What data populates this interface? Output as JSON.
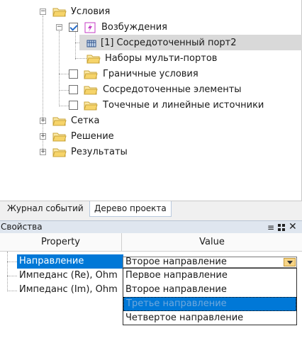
{
  "tree": {
    "nodes": [
      {
        "label": "Условия",
        "icon": "folder-icon",
        "expander": "−",
        "checkbox": null
      },
      {
        "label": "Возбуждения",
        "icon": "excitation-icon",
        "expander": "−",
        "checkbox": "checked"
      },
      {
        "label": "[1] Сосредоточенный порт2",
        "icon": "port-icon",
        "expander": null,
        "checkbox": null
      },
      {
        "label": "Наборы мульти-портов",
        "icon": "folder-icon",
        "expander": null,
        "checkbox": null
      },
      {
        "label": "Граничные условия",
        "icon": "folder-icon",
        "expander": null,
        "checkbox": "unchecked"
      },
      {
        "label": "Сосредоточенные элементы",
        "icon": "folder-icon",
        "expander": null,
        "checkbox": "unchecked"
      },
      {
        "label": "Точечные и линейные источники",
        "icon": "folder-icon",
        "expander": null,
        "checkbox": "unchecked"
      },
      {
        "label": "Сетка",
        "icon": "folder-icon",
        "expander": "+",
        "checkbox": null
      },
      {
        "label": "Решение",
        "icon": "folder-icon",
        "expander": "+",
        "checkbox": null
      },
      {
        "label": "Результаты",
        "icon": "folder-icon",
        "expander": "+",
        "checkbox": null
      }
    ]
  },
  "tabs": [
    {
      "label": "Журнал событий",
      "active": false
    },
    {
      "label": "Дерево проекта",
      "active": true
    }
  ],
  "properties": {
    "title": "Свойства",
    "toolbar_icons": [
      "list-icon",
      "grid-icon",
      "close-icon"
    ],
    "columns": {
      "property": "Property",
      "value": "Value"
    },
    "rows": [
      {
        "name": "Направление",
        "value": "Второе направление",
        "selected": true
      },
      {
        "name": "Импеданс (Re), Ohm",
        "value": "",
        "selected": false
      },
      {
        "name": "Импеданс (Im), Ohm",
        "value": "",
        "selected": false
      }
    ],
    "dropdown_options": [
      {
        "label": "Первое направление",
        "highlighted": false
      },
      {
        "label": "Второе направление",
        "highlighted": false
      },
      {
        "label": "Третье направление",
        "highlighted": true
      },
      {
        "label": "Четвертое направление",
        "highlighted": false
      }
    ]
  },
  "colors": {
    "selection": "#0078d7",
    "folder": "#f6d46a",
    "tree_selection": "#d9d9d9"
  }
}
